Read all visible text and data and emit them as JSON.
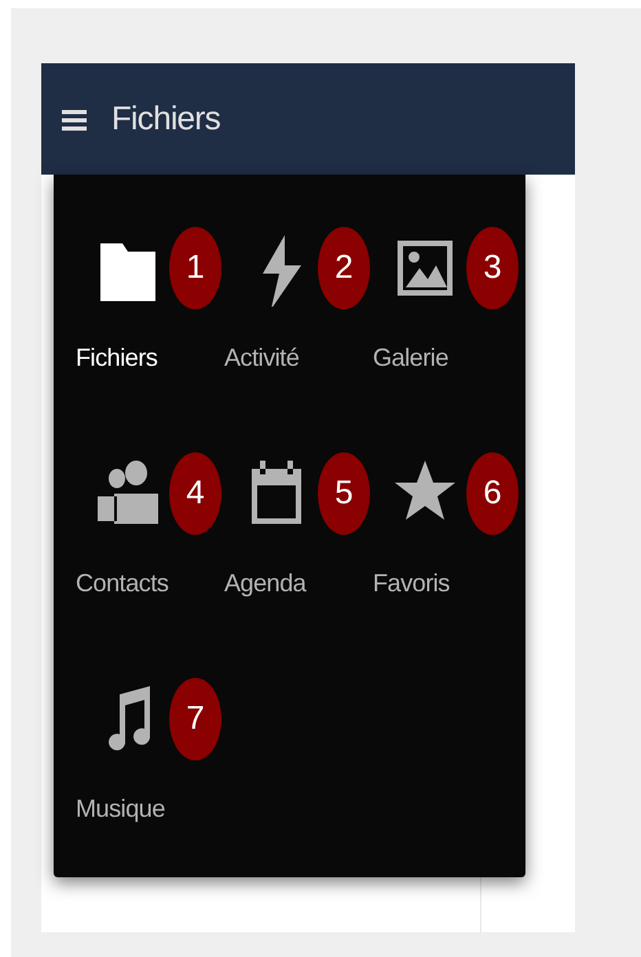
{
  "header": {
    "title": "Fichiers"
  },
  "apps": [
    {
      "label": "Fichiers",
      "badge": "1",
      "selected": true
    },
    {
      "label": "Activité",
      "badge": "2",
      "selected": false
    },
    {
      "label": "Galerie",
      "badge": "3",
      "selected": false
    },
    {
      "label": "Contacts",
      "badge": "4",
      "selected": false
    },
    {
      "label": "Agenda",
      "badge": "5",
      "selected": false
    },
    {
      "label": "Favoris",
      "badge": "6",
      "selected": false
    },
    {
      "label": "Musique",
      "badge": "7",
      "selected": false
    }
  ]
}
